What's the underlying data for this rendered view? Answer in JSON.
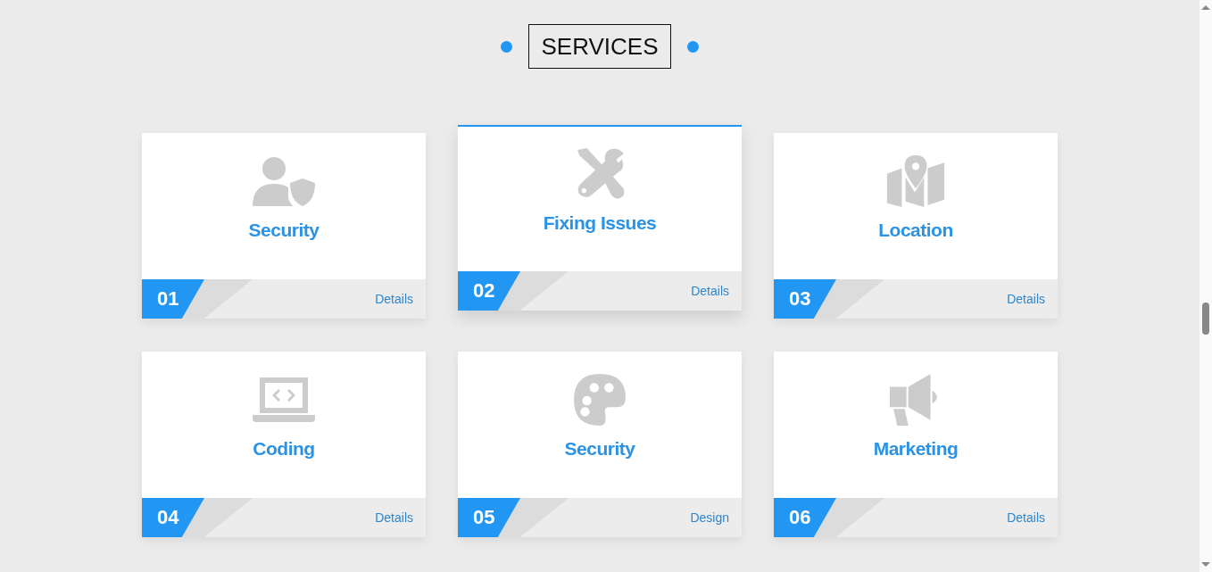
{
  "section_title": "SERVICES",
  "services": [
    {
      "number": "01",
      "title": "Security",
      "kind": "user-shield",
      "link": "Details",
      "raised": false
    },
    {
      "number": "02",
      "title": "Fixing Issues",
      "kind": "tools",
      "link": "Details",
      "raised": true
    },
    {
      "number": "03",
      "title": "Location",
      "kind": "map",
      "link": "Details",
      "raised": false
    },
    {
      "number": "04",
      "title": "Coding",
      "kind": "laptop-code",
      "link": "Details",
      "raised": false
    },
    {
      "number": "05",
      "title": "Security",
      "kind": "palette",
      "link": "Design",
      "raised": false
    },
    {
      "number": "06",
      "title": "Marketing",
      "kind": "megaphone",
      "link": "Details",
      "raised": false
    }
  ]
}
